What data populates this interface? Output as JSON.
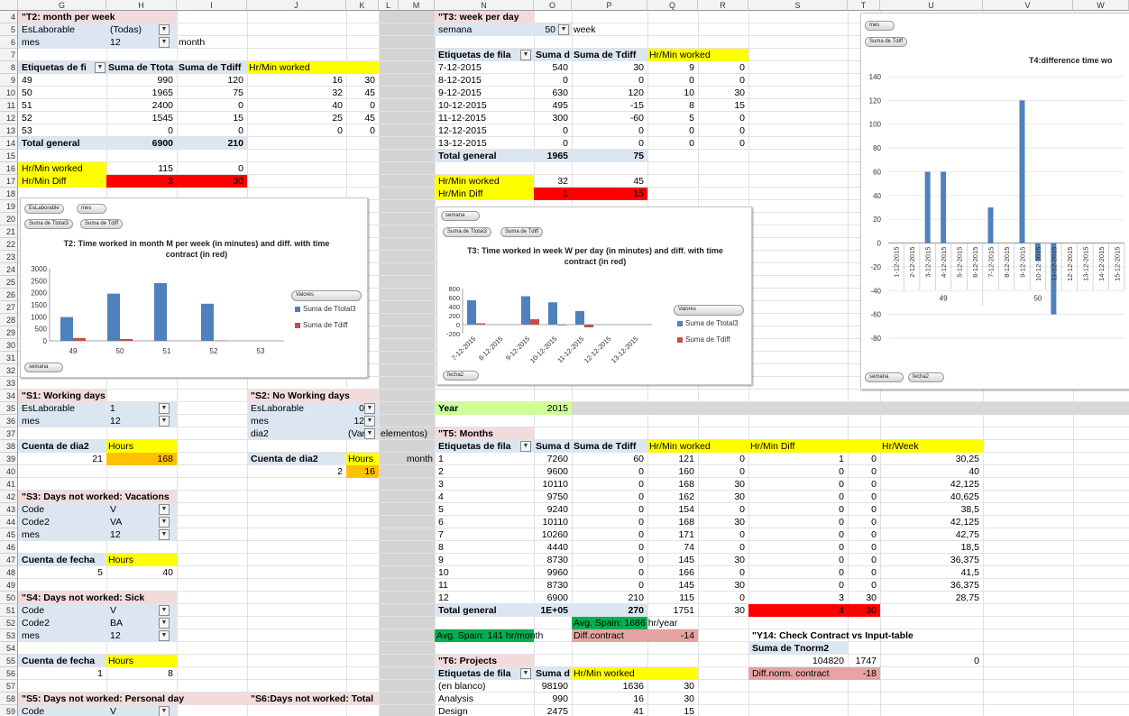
{
  "cols": {
    "G": "G",
    "H": "H",
    "I": "I",
    "J": "J",
    "K": "K",
    "L": "L",
    "M": "M",
    "N": "N",
    "O": "O",
    "P": "P",
    "Q": "Q",
    "R": "R",
    "S": "S",
    "T": "T",
    "U": "U",
    "V": "V",
    "W": "W"
  },
  "rows": [
    "4",
    "5",
    "6",
    "7",
    "8",
    "9",
    "10",
    "11",
    "12",
    "13",
    "14",
    "15",
    "16",
    "17",
    "18",
    "19",
    "20",
    "21",
    "22",
    "23",
    "24",
    "25",
    "26",
    "27",
    "28",
    "29",
    "30",
    "31",
    "32",
    "33",
    "34",
    "35",
    "36",
    "37",
    "38",
    "39",
    "40",
    "41",
    "42",
    "43",
    "44",
    "45",
    "46",
    "47",
    "48",
    "49",
    "50",
    "51",
    "52",
    "53",
    "54",
    "55",
    "56",
    "57",
    "58",
    "59"
  ],
  "t2": {
    "title": "\"T2: month per week",
    "f1_label": "EsLaborable",
    "f1_value": "(Todas)",
    "f2_label": "mes",
    "f2_value": "12",
    "f2_suffix": "month",
    "h1": "Etiquetas de fi",
    "h2": "Suma de Ttota",
    "h3": "Suma de Tdiff",
    "h4": "Hr/Min worked",
    "rows": [
      [
        "49",
        "990",
        "120",
        "16",
        "30"
      ],
      [
        "50",
        "1965",
        "75",
        "32",
        "45"
      ],
      [
        "51",
        "2400",
        "0",
        "40",
        "0"
      ],
      [
        "52",
        "1545",
        "15",
        "25",
        "45"
      ],
      [
        "53",
        "0",
        "0",
        "0",
        "0"
      ]
    ],
    "total_label": "Total general",
    "total_1": "6900",
    "total_2": "210",
    "hm_label": "Hr/Min worked",
    "hm_1": "115",
    "hm_2": "0",
    "hd_label": "Hr/Min Diff",
    "hd_1": "3",
    "hd_2": "30"
  },
  "t3": {
    "title": "\"T3:  week per day",
    "f1_label": "semana",
    "f1_value": "50",
    "f1_suffix": "week",
    "h1": "Etiquetas de fila",
    "h2": "Suma d",
    "h3": "Suma de Tdiff",
    "h4": "Hr/Min worked",
    "rows": [
      [
        "7-12-2015",
        "540",
        "30",
        "9",
        "0"
      ],
      [
        "8-12-2015",
        "0",
        "0",
        "0",
        "0"
      ],
      [
        "9-12-2015",
        "630",
        "120",
        "10",
        "30"
      ],
      [
        "10-12-2015",
        "495",
        "-15",
        "8",
        "15"
      ],
      [
        "11-12-2015",
        "300",
        "-60",
        "5",
        "0"
      ],
      [
        "12-12-2015",
        "0",
        "0",
        "0",
        "0"
      ],
      [
        "13-12-2015",
        "0",
        "0",
        "0",
        "0"
      ]
    ],
    "total_label": "Total general",
    "total_1": "1965",
    "total_2": "75",
    "hm_label": "Hr/Min worked",
    "hm_1": "32",
    "hm_2": "45",
    "hd_label": "Hr/Min Diff",
    "hd_1": "1",
    "hd_2": "15"
  },
  "chart_t2": {
    "pills": [
      "EsLaborable",
      "mes",
      "Suma de Ttotal3",
      "Suma de Tdiff",
      "Valores",
      "semana"
    ],
    "legend": [
      "Suma de Ttotal3",
      "Suma de Tdiff"
    ]
  },
  "chart_t3": {
    "pills": [
      "semana",
      "Suma de Ttotal3",
      "Suma de Tdiff",
      "Valores",
      "fecha2"
    ],
    "legend": [
      "Suma de Ttotal3",
      "Suma de Tdiff"
    ]
  },
  "chart_t4": {
    "pills": [
      "mes",
      "Suma de Tdiff",
      "semana",
      "fecha2"
    ],
    "groups": [
      "49",
      "50"
    ]
  },
  "chart_data": [
    {
      "type": "bar",
      "title": "T2: Time worked in month M per week (in minutes) and diff. with time contract (in red)",
      "categories": [
        "49",
        "50",
        "51",
        "52",
        "53"
      ],
      "series": [
        {
          "name": "Suma de Ttotal3",
          "values": [
            990,
            1965,
            2400,
            1545,
            0
          ],
          "color": "#4f81bd"
        },
        {
          "name": "Suma de Tdiff",
          "values": [
            120,
            75,
            0,
            15,
            0
          ],
          "color": "#c0504d"
        }
      ],
      "ylim": [
        0,
        3000
      ],
      "yticks": [
        0,
        500,
        1000,
        1500,
        2000,
        2500,
        3000
      ],
      "legend": "right"
    },
    {
      "type": "bar",
      "title": "T3: Time worked in week W per day (in minutes) and diff. with time contract (in red)",
      "categories": [
        "7-12-2015",
        "8-12-2015",
        "9-12-2015",
        "10-12-2015",
        "11-12-2015",
        "12-12-2015",
        "13-12-2015"
      ],
      "series": [
        {
          "name": "Suma de Ttotal3",
          "values": [
            540,
            0,
            630,
            495,
            300,
            0,
            0
          ],
          "color": "#4f81bd"
        },
        {
          "name": "Suma de Tdiff",
          "values": [
            30,
            0,
            120,
            -15,
            -60,
            0,
            0
          ],
          "color": "#c0504d"
        }
      ],
      "ylim": [
        -200,
        800
      ],
      "yticks": [
        -200,
        0,
        200,
        400,
        600,
        800
      ],
      "legend": "right"
    },
    {
      "type": "bar",
      "title": "T4:difference time wo",
      "categories": [
        "1-12-2015",
        "2-12-2015",
        "3-12-2015",
        "4-12-2015",
        "5-12-2015",
        "6-12-2015",
        "7-12-2015",
        "8-12-2015",
        "9-12-2015",
        "10-12-2015",
        "11-12-2015",
        "12-12-2015",
        "13-12-2015",
        "14-12-2015",
        "15-12-2015"
      ],
      "series": [
        {
          "name": "Suma de Tdiff",
          "values": [
            0,
            0,
            60,
            60,
            0,
            0,
            30,
            0,
            120,
            -15,
            -60,
            0,
            0,
            0,
            0
          ],
          "color": "#4f81bd"
        }
      ],
      "ylim": [
        -80,
        140
      ],
      "yticks": [
        -80,
        -60,
        -40,
        -20,
        0,
        20,
        40,
        60,
        80,
        100,
        120,
        140
      ]
    }
  ],
  "year": {
    "label": "Year",
    "value": "2015"
  },
  "t5": {
    "title": "\"T5: Months",
    "side_label": "month",
    "h1": "Etiquetas de fila",
    "h2": "Suma d",
    "h3": "Suma de Tdiff",
    "h4": "Hr/Min worked",
    "h5": "Hr/Min Diff",
    "h6": "Hr/Week",
    "rows": [
      [
        "1",
        "7260",
        "60",
        "121",
        "0",
        "1",
        "0",
        "30,25"
      ],
      [
        "2",
        "9600",
        "0",
        "160",
        "0",
        "0",
        "0",
        "40"
      ],
      [
        "3",
        "10110",
        "0",
        "168",
        "30",
        "0",
        "0",
        "42,125"
      ],
      [
        "4",
        "9750",
        "0",
        "162",
        "30",
        "0",
        "0",
        "40,625"
      ],
      [
        "5",
        "9240",
        "0",
        "154",
        "0",
        "0",
        "0",
        "38,5"
      ],
      [
        "6",
        "10110",
        "0",
        "168",
        "30",
        "0",
        "0",
        "42,125"
      ],
      [
        "7",
        "10260",
        "0",
        "171",
        "0",
        "0",
        "0",
        "42,75"
      ],
      [
        "8",
        "4440",
        "0",
        "74",
        "0",
        "0",
        "0",
        "18,5"
      ],
      [
        "9",
        "8730",
        "0",
        "145",
        "30",
        "0",
        "0",
        "36,375"
      ],
      [
        "10",
        "9960",
        "0",
        "166",
        "0",
        "0",
        "0",
        "41,5"
      ],
      [
        "11",
        "8730",
        "0",
        "145",
        "30",
        "0",
        "0",
        "36,375"
      ],
      [
        "12",
        "6900",
        "210",
        "115",
        "0",
        "3",
        "30",
        "28,75"
      ]
    ],
    "total_label": "Total general",
    "total_1": "1E+05",
    "total_2": "270",
    "total_3": "1751",
    "total_4": "30",
    "total_5": "4",
    "total_6": "30",
    "avg_spain_year": "Avg. Spain: 1686 hr/year",
    "avg_spain_month": "Avg. Spain: 141 hr/month",
    "diff_label": "Diff.contract",
    "diff_value": "-14"
  },
  "t6": {
    "title": "\"T6: Projects",
    "h1": "Etiquetas de fila",
    "h2": "Suma d",
    "h3": "Hr/Min worked",
    "rows": [
      [
        "(en blanco)",
        "98190",
        "1636",
        "30"
      ],
      [
        "Analysis",
        "990",
        "16",
        "30"
      ],
      [
        "Design",
        "2475",
        "41",
        "15"
      ]
    ]
  },
  "y14": {
    "title": "\"Y14: Check Contract vs Input-table",
    "h1": "Suma de Tnorm2",
    "v1": "104820",
    "v2": "1747",
    "v3": "0",
    "diff_label": "Diff.norm. contract",
    "diff_value": "-18"
  },
  "s1": {
    "title": "\"S1: Working days",
    "f1_label": "EsLaborable",
    "f1_value": "1",
    "f2_label": "mes",
    "f2_value": "12",
    "h1": "Cuenta de dia2",
    "h2": "Hours",
    "v1": "21",
    "v2": "168"
  },
  "s2": {
    "title": "\"S2: No Working days",
    "f1_label": "EsLaborable",
    "f1_value": "0",
    "f2_label": "mes",
    "f2_value": "12",
    "f3_label": "dia2",
    "f3_value": "(Var",
    "f3_suffix": "elementos)",
    "h1": "Cuenta de dia2",
    "h2": "Hours",
    "v1": "2",
    "v2": "16"
  },
  "s3": {
    "title": "\"S3: Days not worked: Vacations",
    "f1_label": "Code",
    "f1_value": "V",
    "f2_label": "Code2",
    "f2_value": "VA",
    "f3_label": "mes",
    "f3_value": "12",
    "h1": "Cuenta de fecha",
    "h2": "Hours",
    "v1": "5",
    "v2": "40"
  },
  "s4": {
    "title": "\"S4: Days not worked: Sick",
    "f1_label": "Code",
    "f1_value": "V",
    "f2_label": "Code2",
    "f2_value": "BA",
    "f3_label": "mes",
    "f3_value": "12",
    "h1": "Cuenta de fecha",
    "h2": "Hours",
    "v1": "1",
    "v2": "8"
  },
  "s5": {
    "title": "\"S5: Days not worked:  Personal day",
    "f1_label": "Code",
    "f1_value": "V"
  },
  "s6": {
    "title": "\"S6:Days not worked: Total"
  },
  "icons": {
    "dropdown": "dropdown-arrow-icon",
    "filter": "filter-icon"
  }
}
